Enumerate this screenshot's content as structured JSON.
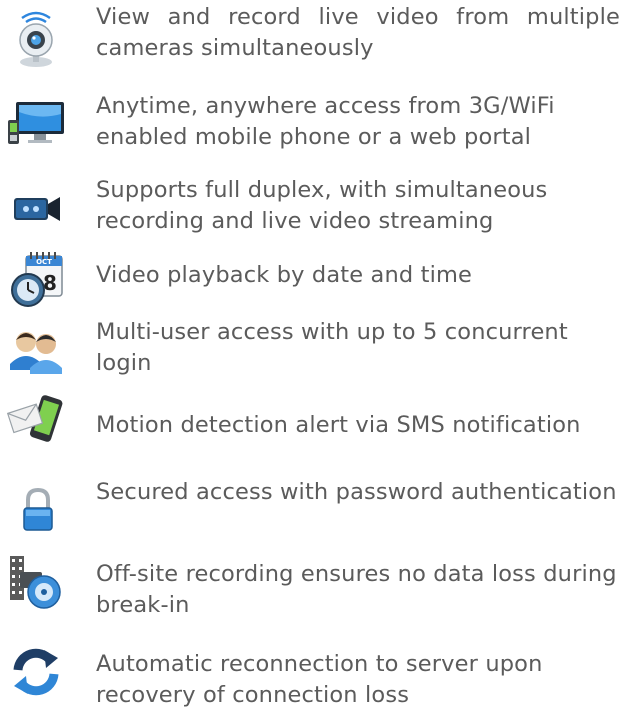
{
  "features": [
    {
      "icon": "webcam-icon",
      "text": "View and record live video from multiple cameras simultaneously"
    },
    {
      "icon": "computer-phone-icon",
      "text": "Anytime, anywhere access from 3G/WiFi enabled mobile phone or a web portal"
    },
    {
      "icon": "video-camera-icon",
      "text": "Supports full duplex, with simultaneous recording and live video streaming"
    },
    {
      "icon": "calendar-clock-icon",
      "text": "Video playback by date and time",
      "calendar_month": "OCT",
      "calendar_day": "8"
    },
    {
      "icon": "users-icon",
      "text": "Multi-user access with up to 5 concurrent login"
    },
    {
      "icon": "sms-phone-icon",
      "text": "Motion detection alert via SMS notification"
    },
    {
      "icon": "padlock-icon",
      "text": "Secured access with password authentication"
    },
    {
      "icon": "offsite-recording-icon",
      "text": "Off-site recording ensures no data loss during break-in"
    },
    {
      "icon": "reconnect-icon",
      "text": "Automatic reconnection to server upon recovery of connection loss"
    }
  ],
  "colors": {
    "text": "#5b5b5b",
    "accent_blue": "#1e73c8"
  }
}
